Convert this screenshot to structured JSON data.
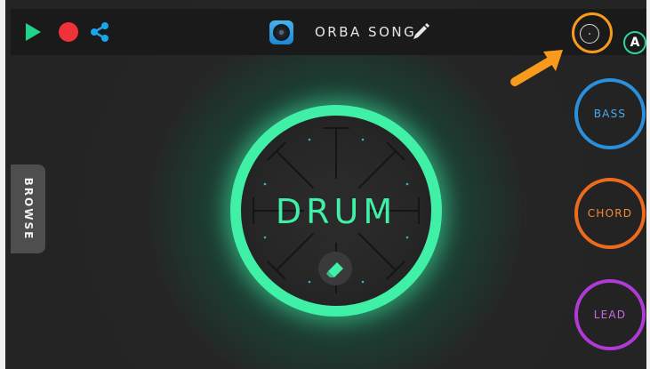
{
  "topbar": {
    "song_title": "ORBA SONG",
    "icons": [
      "play-icon",
      "record-icon",
      "share-icon",
      "song-disc-icon",
      "pencil-icon",
      "orba-device-icon",
      "account-a-icon"
    ],
    "account_letter": "A"
  },
  "sidebar": {
    "browse_label": "BROWSE"
  },
  "main": {
    "drum_label": "DRUM",
    "eraser_icon": "eraser-icon"
  },
  "modes": [
    {
      "label": "BASS",
      "color": "#2a8fdc"
    },
    {
      "label": "CHORD",
      "color": "#ee6a1c"
    },
    {
      "label": "LEAD",
      "color": "#b03ad6"
    }
  ],
  "colors": {
    "accent_green": "#3ff0a6",
    "record_red": "#f0323a",
    "highlight_orange": "#f89b1c"
  }
}
